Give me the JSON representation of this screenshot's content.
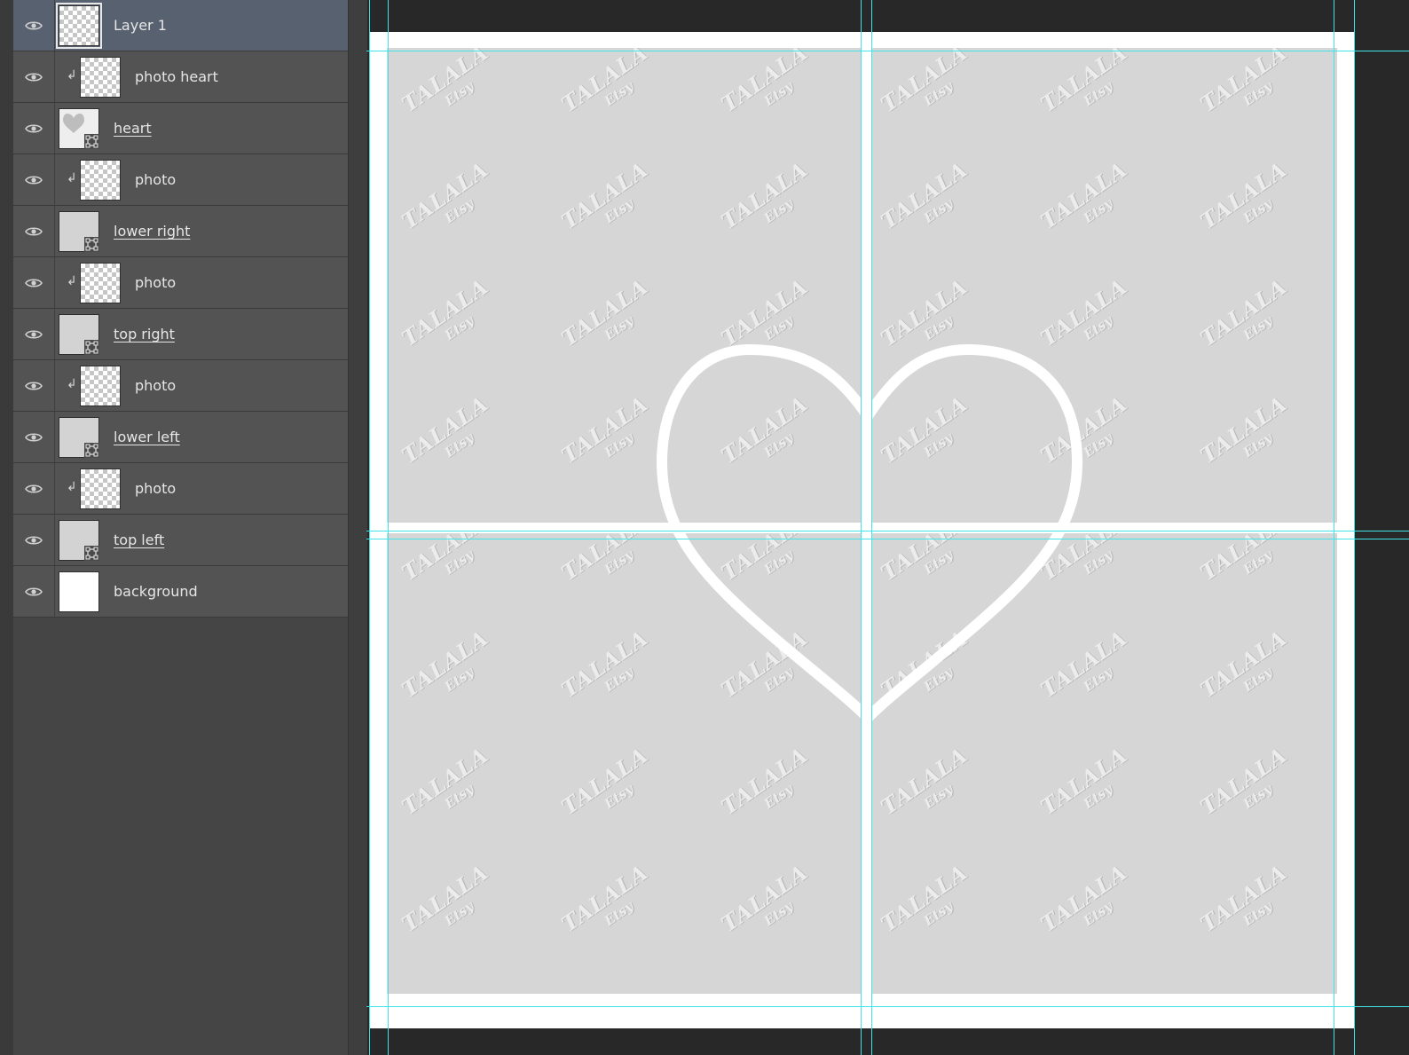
{
  "layers_panel": {
    "layers": [
      {
        "name": "Layer 1",
        "thumb": "checker",
        "clipped": false,
        "underline": false,
        "selected": true
      },
      {
        "name": "photo heart",
        "thumb": "checker",
        "clipped": true,
        "underline": false,
        "selected": false
      },
      {
        "name": "heart",
        "thumb": "heart-shape",
        "clipped": false,
        "underline": true,
        "selected": false
      },
      {
        "name": "photo",
        "thumb": "checker",
        "clipped": true,
        "underline": false,
        "selected": false
      },
      {
        "name": "lower right",
        "thumb": "shape",
        "clipped": false,
        "underline": true,
        "selected": false
      },
      {
        "name": "photo",
        "thumb": "checker",
        "clipped": true,
        "underline": false,
        "selected": false
      },
      {
        "name": "top right",
        "thumb": "shape",
        "clipped": false,
        "underline": true,
        "selected": false
      },
      {
        "name": "photo",
        "thumb": "checker",
        "clipped": true,
        "underline": false,
        "selected": false
      },
      {
        "name": "lower left",
        "thumb": "shape",
        "clipped": false,
        "underline": true,
        "selected": false
      },
      {
        "name": "photo",
        "thumb": "checker",
        "clipped": true,
        "underline": false,
        "selected": false
      },
      {
        "name": "top left",
        "thumb": "shape",
        "clipped": false,
        "underline": true,
        "selected": false
      },
      {
        "name": "background",
        "thumb": "white",
        "clipped": false,
        "underline": false,
        "selected": false
      }
    ],
    "icons": {
      "visibility": "eye-icon",
      "clipping": "clipping-mask-icon",
      "shape_badge": "vector-shape-icon"
    }
  },
  "canvas": {
    "watermark": {
      "line1": "TALALA",
      "line2": "Etsy"
    },
    "colors": {
      "placeholder": "#d6d6d6",
      "document": "#ffffff",
      "guide": "#3fe3e8",
      "pasteboard": "#282828",
      "heart_stroke": "#ffffff"
    }
  }
}
